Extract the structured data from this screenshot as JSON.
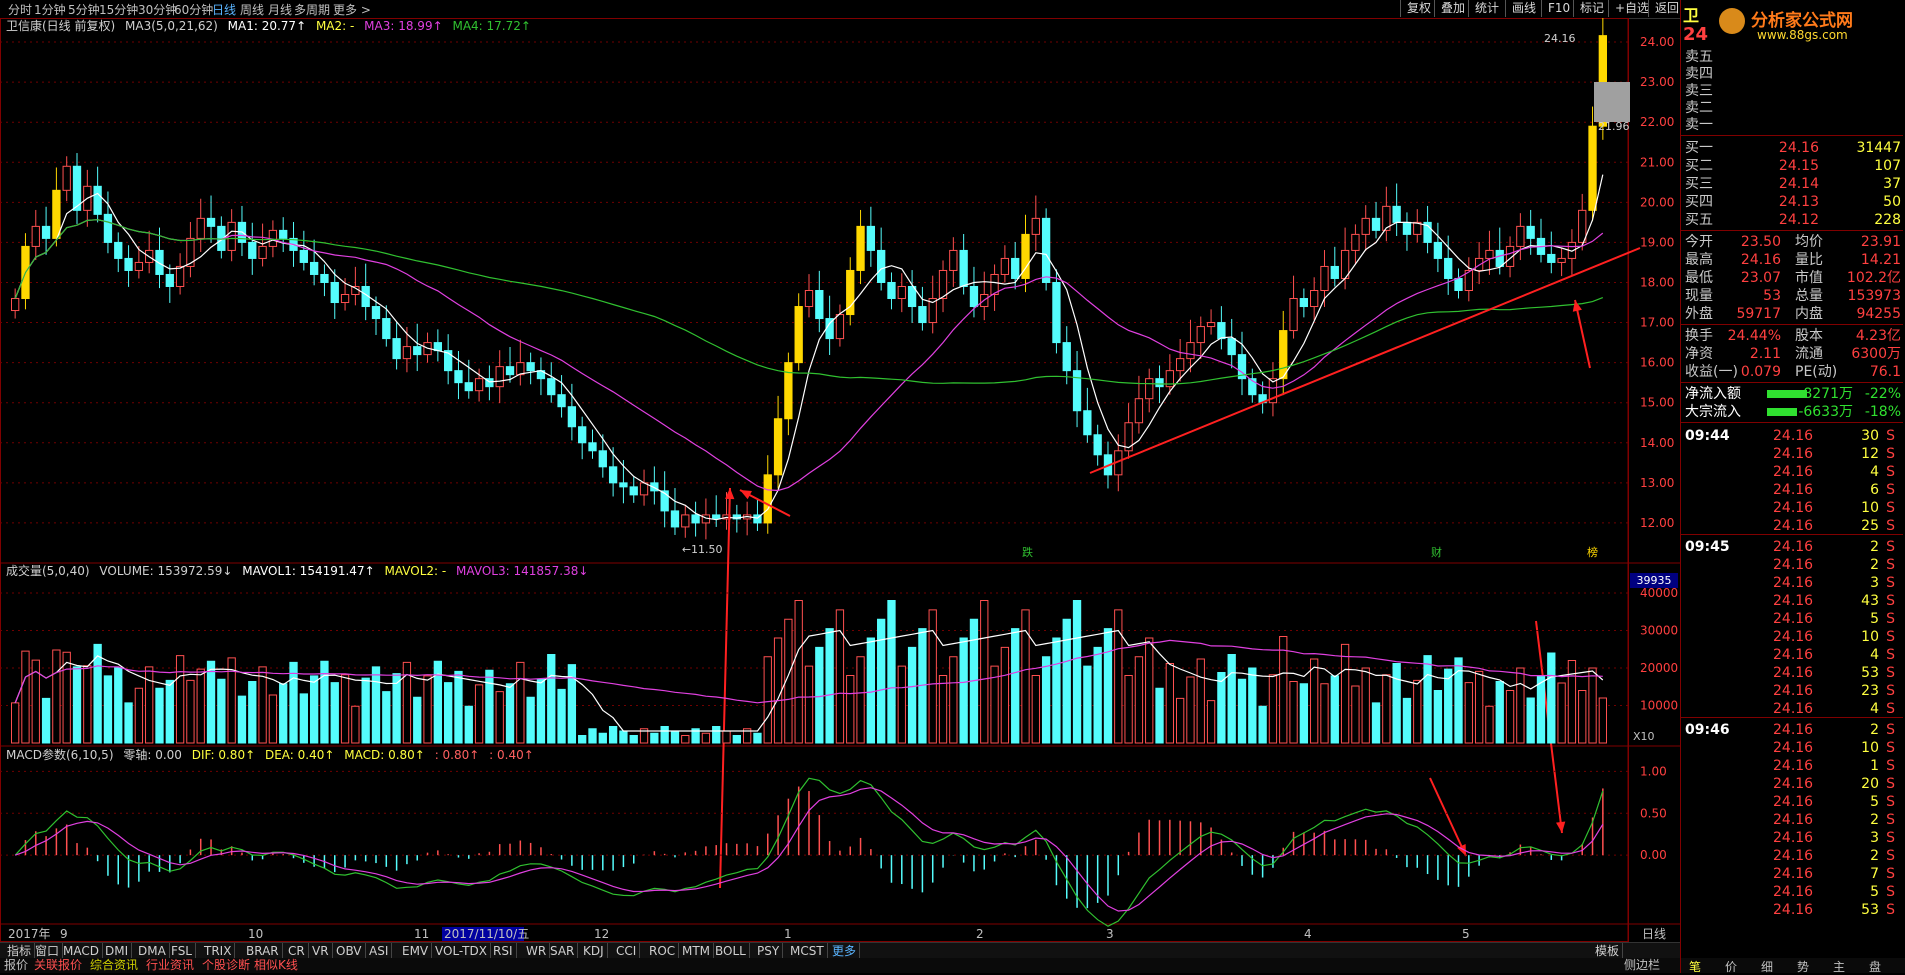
{
  "toolbar": {
    "periods": [
      "分时",
      "1分钟",
      "5分钟",
      "15分钟",
      "30分钟",
      "60分钟",
      "日线",
      "周线",
      "月线",
      "多周期",
      "更多 >"
    ],
    "active_period": "日线",
    "right_buttons": [
      "复权",
      "叠加",
      "统计",
      "画线",
      "F10",
      "标记",
      "+自选",
      "返回"
    ]
  },
  "chart": {
    "stock_name": "卫信康(日线 前复权)",
    "ma_label": "MA3(5,0,21,62)",
    "ma1": "MA1: 20.77↑",
    "ma2": "MA2: -",
    "ma3": "MA3: 18.99↑",
    "ma4": "MA4: 17.72↑",
    "low_label": "11.50",
    "high_label": "24.16",
    "mark_label": "21.96",
    "event_labels": [
      "跌",
      "财",
      "榜"
    ],
    "colors": {
      "up": "#ff5050",
      "down": "#54fcfc",
      "yellow": "#ffd800",
      "ma_white": "#ffffff",
      "ma_magenta": "#e040e0",
      "ma_green": "#30c030",
      "grid": "#700000"
    }
  },
  "volume": {
    "label": "成交量(5,0,40)",
    "vol": "VOLUME: 153972.59↓",
    "mavol1": "MAVOL1: 154191.47↑",
    "mavol2": "MAVOL2: -",
    "mavol3": "MAVOL3: 141857.38↓",
    "cur_box": "39935",
    "unit": "X10"
  },
  "macd": {
    "label": "MACD参数(6,10,5)",
    "zero": "零轴: 0.00",
    "dif": "DIF: 0.80↑",
    "dea": "DEA: 0.40↑",
    "macd": "MACD: 0.80↑",
    "x1": ": 0.80↑",
    "x2": ": 0.40↑"
  },
  "price_axis": [
    "24.00",
    "23.00",
    "22.00",
    "21.00",
    "20.00",
    "19.00",
    "18.00",
    "17.00",
    "16.00",
    "15.00",
    "14.00",
    "13.00",
    "12.00"
  ],
  "vol_axis": [
    "40000",
    "30000",
    "20000",
    "10000"
  ],
  "macd_axis": [
    "1.00",
    "0.50",
    "0.00"
  ],
  "date_axis": [
    {
      "label": "2017年"
    },
    {
      "label": "9"
    },
    {
      "label": "10"
    },
    {
      "label": "11"
    },
    {
      "label": "2017/11/10/五",
      "highlight": true
    },
    {
      "label": "12"
    },
    {
      "label": "1"
    },
    {
      "label": "2"
    },
    {
      "label": "3"
    },
    {
      "label": "4"
    },
    {
      "label": "5"
    }
  ],
  "date_axis_right": "日线",
  "index_tabs": [
    "指标",
    "窗口",
    "MACD",
    "DMI",
    "DMA",
    "FSL",
    "TRIX",
    "BRAR",
    "CR",
    "VR",
    "OBV",
    "ASI",
    "EMV",
    "VOL-TDX",
    "RSI",
    "WR",
    "SAR",
    "KDJ",
    "CCI",
    "ROC",
    "MTM",
    "BOLL",
    "PSY",
    "MCST",
    "更多"
  ],
  "index_right": "模板",
  "bottom_tabs": [
    "报价",
    "关联报价",
    "综合资讯",
    "行业资讯",
    "个股诊断",
    "相似K线"
  ],
  "bottom_right": "侧边栏",
  "panel_tabs_bottom": [
    "笔",
    "价",
    "细",
    "势",
    "主",
    "盘"
  ],
  "quote": {
    "name_short": "卫",
    "price_short": "24",
    "logo_text": "分析家公式网",
    "logo_url": "www.88gs.com",
    "sell": [
      {
        "label": "卖五",
        "price": "",
        "vol": ""
      },
      {
        "label": "卖四",
        "price": "",
        "vol": ""
      },
      {
        "label": "卖三",
        "price": "",
        "vol": ""
      },
      {
        "label": "卖二",
        "price": "",
        "vol": ""
      },
      {
        "label": "卖一",
        "price": "",
        "vol": ""
      }
    ],
    "buy": [
      {
        "label": "买一",
        "price": "24.16",
        "vol": "31447"
      },
      {
        "label": "买二",
        "price": "24.15",
        "vol": "107"
      },
      {
        "label": "买三",
        "price": "24.14",
        "vol": "37"
      },
      {
        "label": "买四",
        "price": "24.13",
        "vol": "50"
      },
      {
        "label": "买五",
        "price": "24.12",
        "vol": "228"
      }
    ],
    "stats": [
      {
        "l1": "今开",
        "v1": "23.50",
        "l2": "均价",
        "v2": "23.91"
      },
      {
        "l1": "最高",
        "v1": "24.16",
        "l2": "量比",
        "v2": "14.21"
      },
      {
        "l1": "最低",
        "v1": "23.07",
        "l2": "市值",
        "v2": "102.2亿"
      },
      {
        "l1": "现量",
        "v1": "53",
        "l2": "总量",
        "v2": "153973"
      },
      {
        "l1": "外盘",
        "v1": "59717",
        "l2": "内盘",
        "v2": "94255"
      }
    ],
    "stats2": [
      {
        "l1": "换手",
        "v1": "24.44%",
        "l2": "股本",
        "v2": "4.23亿"
      },
      {
        "l1": "净资",
        "v1": "2.11",
        "l2": "流通",
        "v2": "6300万"
      },
      {
        "l1": "收益(一)",
        "v1": "0.079",
        "l2": "PE(动)",
        "v2": "76.1"
      }
    ],
    "flows": [
      {
        "label": "净流入额",
        "val": "-8271万",
        "pct": "-22%"
      },
      {
        "label": "大宗流入",
        "val": "-6633万",
        "pct": "-18%"
      }
    ]
  },
  "ticks": [
    {
      "t": "09:44",
      "p": "24.16",
      "v": "30",
      "s": "S"
    },
    {
      "t": "",
      "p": "24.16",
      "v": "12",
      "s": "S"
    },
    {
      "t": "",
      "p": "24.16",
      "v": "4",
      "s": "S"
    },
    {
      "t": "",
      "p": "24.16",
      "v": "6",
      "s": "S"
    },
    {
      "t": "",
      "p": "24.16",
      "v": "10",
      "s": "S"
    },
    {
      "t": "",
      "p": "24.16",
      "v": "25",
      "s": "S"
    },
    {
      "t": "09:45",
      "p": "24.16",
      "v": "2",
      "s": "S"
    },
    {
      "t": "",
      "p": "24.16",
      "v": "2",
      "s": "S"
    },
    {
      "t": "",
      "p": "24.16",
      "v": "3",
      "s": "S"
    },
    {
      "t": "",
      "p": "24.16",
      "v": "43",
      "s": "S"
    },
    {
      "t": "",
      "p": "24.16",
      "v": "5",
      "s": "S"
    },
    {
      "t": "",
      "p": "24.16",
      "v": "10",
      "s": "S"
    },
    {
      "t": "",
      "p": "24.16",
      "v": "4",
      "s": "S"
    },
    {
      "t": "",
      "p": "24.16",
      "v": "53",
      "s": "S"
    },
    {
      "t": "",
      "p": "24.16",
      "v": "23",
      "s": "S"
    },
    {
      "t": "",
      "p": "24.16",
      "v": "4",
      "s": "S"
    },
    {
      "t": "09:46",
      "p": "24.16",
      "v": "2",
      "s": "S"
    },
    {
      "t": "",
      "p": "24.16",
      "v": "10",
      "s": "S"
    },
    {
      "t": "",
      "p": "24.16",
      "v": "1",
      "s": "S"
    },
    {
      "t": "",
      "p": "24.16",
      "v": "20",
      "s": "S"
    },
    {
      "t": "",
      "p": "24.16",
      "v": "5",
      "s": "S"
    },
    {
      "t": "",
      "p": "24.16",
      "v": "2",
      "s": "S"
    },
    {
      "t": "",
      "p": "24.16",
      "v": "3",
      "s": "S"
    },
    {
      "t": "",
      "p": "24.16",
      "v": "2",
      "s": "S"
    },
    {
      "t": "",
      "p": "24.16",
      "v": "7",
      "s": "S"
    },
    {
      "t": "",
      "p": "24.16",
      "v": "5",
      "s": "S"
    },
    {
      "t": "",
      "p": "24.16",
      "v": "53",
      "s": "S"
    }
  ],
  "chart_data": {
    "type": "candlestick",
    "close": [
      17.6,
      18.9,
      19.4,
      19.1,
      20.3,
      20.9,
      19.8,
      20.4,
      19.7,
      19.0,
      18.6,
      18.3,
      18.5,
      18.8,
      18.2,
      17.9,
      18.4,
      19.1,
      19.6,
      19.4,
      18.8,
      19.5,
      19.0,
      18.6,
      18.9,
      19.3,
      19.1,
      18.8,
      18.5,
      18.2,
      18.0,
      17.5,
      17.7,
      17.9,
      17.4,
      17.1,
      16.6,
      16.1,
      16.4,
      16.2,
      16.5,
      16.3,
      15.8,
      15.5,
      15.3,
      15.6,
      15.4,
      15.9,
      15.7,
      16.0,
      15.8,
      15.6,
      15.2,
      14.9,
      14.4,
      14.0,
      13.8,
      13.4,
      13.0,
      12.9,
      12.7,
      13.0,
      12.8,
      12.3,
      11.9,
      12.2,
      12.0,
      12.2,
      12.1,
      12.2,
      12.1,
      12.2,
      12.0,
      13.2,
      14.6,
      16.0,
      17.4,
      17.8,
      17.1,
      16.6,
      17.2,
      18.3,
      19.4,
      18.8,
      18.0,
      17.6,
      17.9,
      17.4,
      17.0,
      17.6,
      18.3,
      18.8,
      17.9,
      17.4,
      17.7,
      18.2,
      18.6,
      18.1,
      19.2,
      19.6,
      18.0,
      16.5,
      15.8,
      14.8,
      14.2,
      13.7,
      13.2,
      13.8,
      14.5,
      15.1,
      15.6,
      15.4,
      15.8,
      16.1,
      16.5,
      16.9,
      17.0,
      16.6,
      16.2,
      15.6,
      15.2,
      15.0,
      15.6,
      16.8,
      17.6,
      17.4,
      17.8,
      18.4,
      18.1,
      18.8,
      19.2,
      19.6,
      19.3,
      19.9,
      19.5,
      19.2,
      19.5,
      19.0,
      18.6,
      18.1,
      17.8,
      18.3,
      18.6,
      18.8,
      18.4,
      18.9,
      19.4,
      19.1,
      18.7,
      18.5,
      18.6,
      19.0,
      19.8,
      21.9,
      24.16
    ]
  }
}
